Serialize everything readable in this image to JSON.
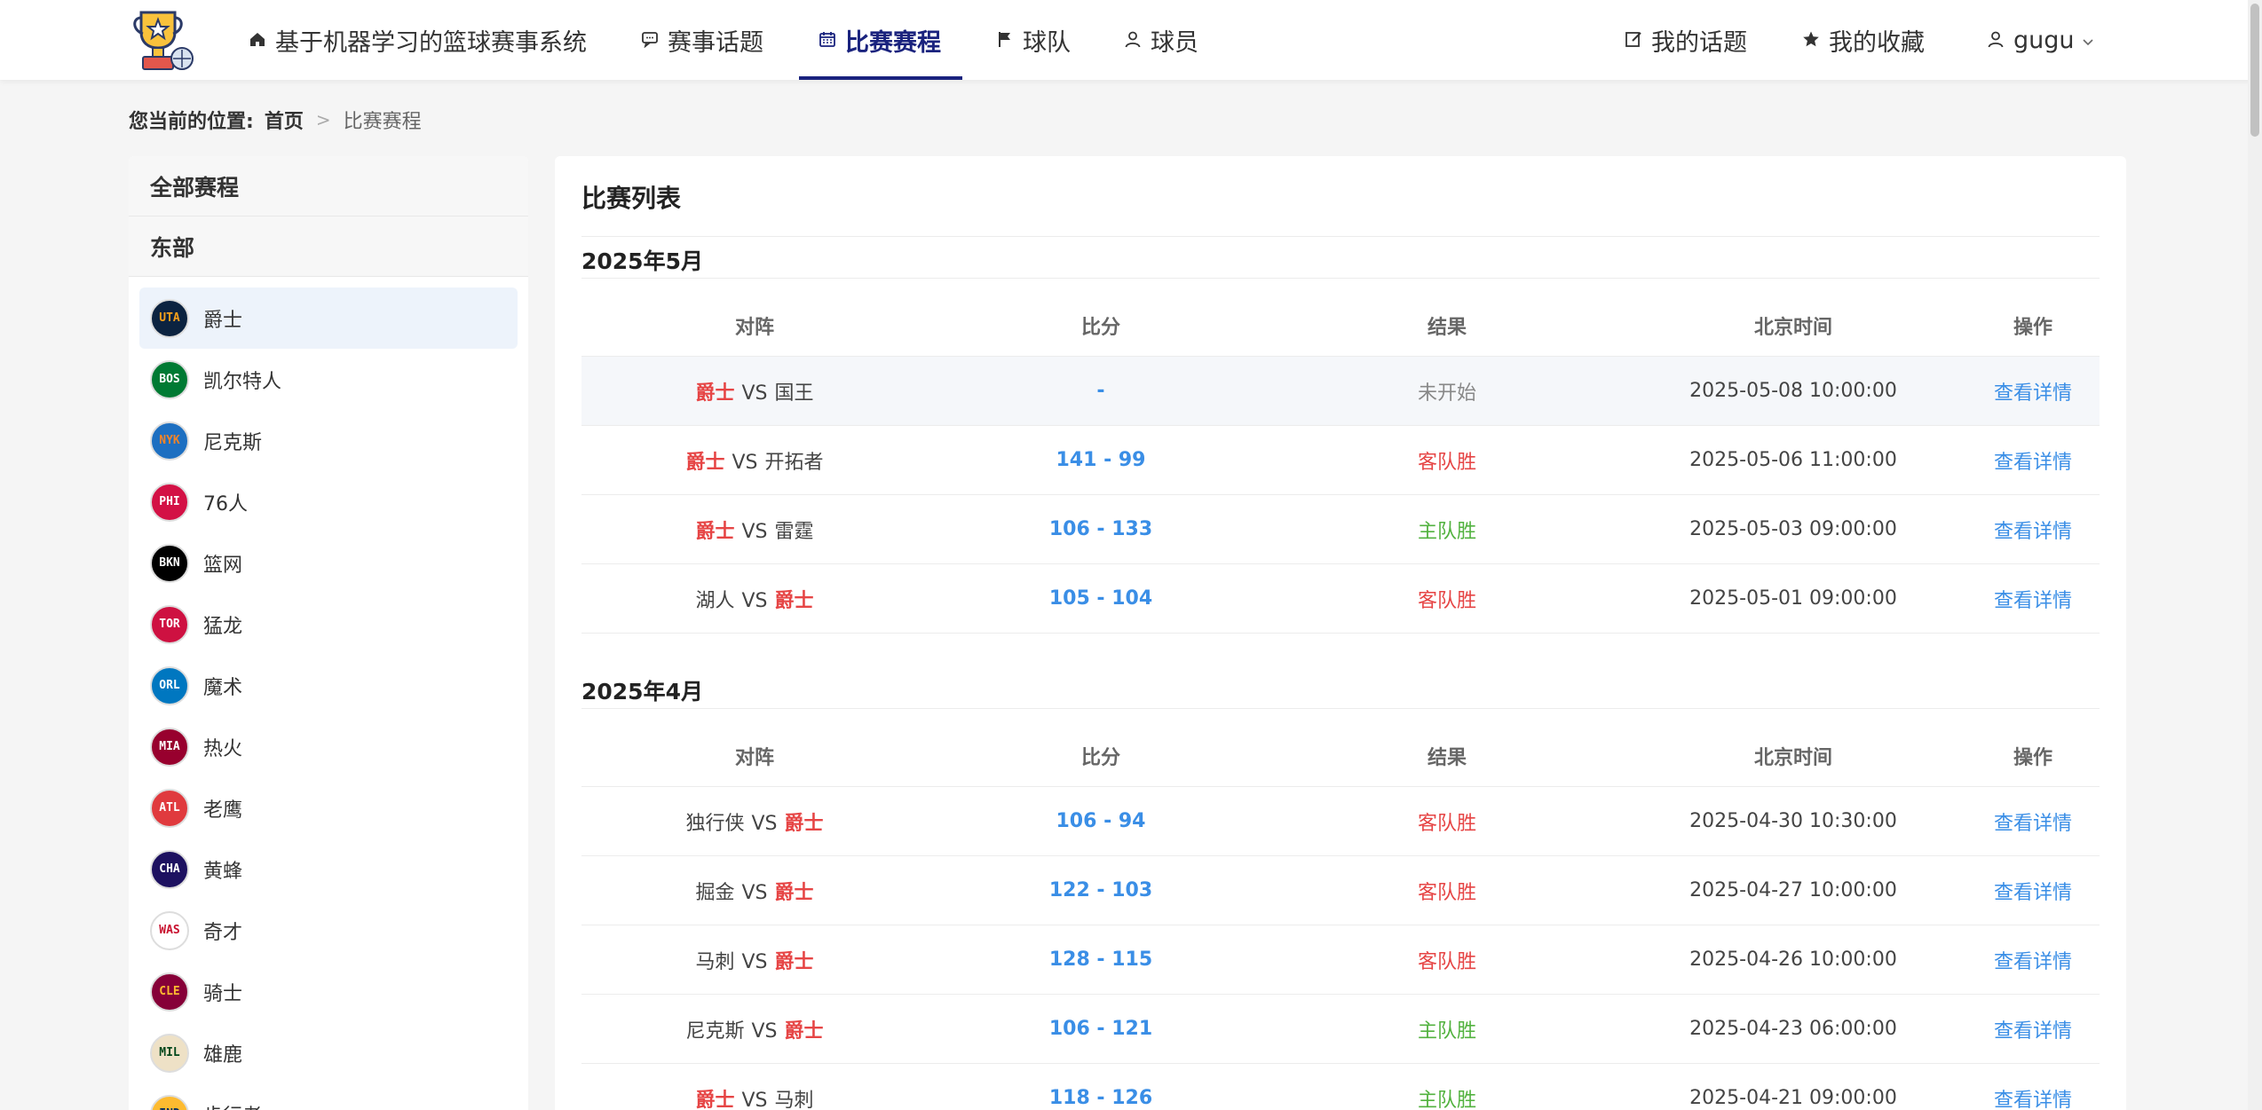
{
  "nav": {
    "brand_label": "基于机器学习的篮球赛事系统",
    "topics_label": "赛事话题",
    "schedule_label": "比赛赛程",
    "teams_label": "球队",
    "players_label": "球员",
    "my_topics_label": "我的话题",
    "favorites_label": "我的收藏",
    "user_label": "gugu"
  },
  "breadcrumb": {
    "label": "您当前的位置:",
    "home": "首页",
    "separator": ">",
    "current": "比赛赛程"
  },
  "sidebar": {
    "all_label": "全部赛程",
    "group_label": "东部",
    "teams": [
      {
        "abbr": "UTA",
        "name": "爵士",
        "bg": "#0c2340",
        "fg": "#f9a01b"
      },
      {
        "abbr": "BOS",
        "name": "凯尔特人",
        "bg": "#007a33",
        "fg": "#ffffff"
      },
      {
        "abbr": "NYK",
        "name": "尼克斯",
        "bg": "#1d6fc1",
        "fg": "#f58426"
      },
      {
        "abbr": "PHI",
        "name": "76人",
        "bg": "#d31145",
        "fg": "#ffffff"
      },
      {
        "abbr": "BKN",
        "name": "篮网",
        "bg": "#000000",
        "fg": "#ffffff"
      },
      {
        "abbr": "TOR",
        "name": "猛龙",
        "bg": "#ce1141",
        "fg": "#ffffff"
      },
      {
        "abbr": "ORL",
        "name": "魔术",
        "bg": "#0077c0",
        "fg": "#ffffff"
      },
      {
        "abbr": "MIA",
        "name": "热火",
        "bg": "#98002e",
        "fg": "#ffffff"
      },
      {
        "abbr": "ATL",
        "name": "老鹰",
        "bg": "#e03a3e",
        "fg": "#ffffff"
      },
      {
        "abbr": "CHA",
        "name": "黄蜂",
        "bg": "#1d1160",
        "fg": "#ffffff"
      },
      {
        "abbr": "WAS",
        "name": "奇才",
        "bg": "#ffffff",
        "fg": "#c8102e"
      },
      {
        "abbr": "CLE",
        "name": "骑士",
        "bg": "#860038",
        "fg": "#fdbb30"
      },
      {
        "abbr": "MIL",
        "name": "雄鹿",
        "bg": "#eee1c6",
        "fg": "#00471b"
      },
      {
        "abbr": "IND",
        "name": "步行者",
        "bg": "#fdbb30",
        "fg": "#002d62"
      }
    ]
  },
  "main": {
    "title": "比赛列表",
    "headers": {
      "matchup": "对阵",
      "score": "比分",
      "result": "结果",
      "time": "北京时间",
      "action": "操作"
    },
    "months": [
      {
        "title": "2025年5月",
        "games": [
          {
            "home": "爵士",
            "vs": "VS",
            "away": "国王",
            "jazz_side": "home",
            "score": "-",
            "result": "未开始",
            "result_type": "pending",
            "time": "2025-05-08 10:00:00",
            "action": "查看详情",
            "highlight": true
          },
          {
            "home": "爵士",
            "vs": "VS",
            "away": "开拓者",
            "jazz_side": "home",
            "score": "141 - 99",
            "result": "客队胜",
            "result_type": "away",
            "time": "2025-05-06 11:00:00",
            "action": "查看详情",
            "highlight": false
          },
          {
            "home": "爵士",
            "vs": "VS",
            "away": "雷霆",
            "jazz_side": "home",
            "score": "106 - 133",
            "result": "主队胜",
            "result_type": "home",
            "time": "2025-05-03 09:00:00",
            "action": "查看详情",
            "highlight": false
          },
          {
            "home": "湖人",
            "vs": "VS",
            "away": "爵士",
            "jazz_side": "away",
            "score": "105 - 104",
            "result": "客队胜",
            "result_type": "away",
            "time": "2025-05-01 09:00:00",
            "action": "查看详情",
            "highlight": false
          }
        ]
      },
      {
        "title": "2025年4月",
        "games": [
          {
            "home": "独行侠",
            "vs": "VS",
            "away": "爵士",
            "jazz_side": "away",
            "score": "106 - 94",
            "result": "客队胜",
            "result_type": "away",
            "time": "2025-04-30 10:30:00",
            "action": "查看详情",
            "highlight": false
          },
          {
            "home": "掘金",
            "vs": "VS",
            "away": "爵士",
            "jazz_side": "away",
            "score": "122 - 103",
            "result": "客队胜",
            "result_type": "away",
            "time": "2025-04-27 10:00:00",
            "action": "查看详情",
            "highlight": false
          },
          {
            "home": "马刺",
            "vs": "VS",
            "away": "爵士",
            "jazz_side": "away",
            "score": "128 - 115",
            "result": "客队胜",
            "result_type": "away",
            "time": "2025-04-26 10:00:00",
            "action": "查看详情",
            "highlight": false
          },
          {
            "home": "尼克斯",
            "vs": "VS",
            "away": "爵士",
            "jazz_side": "away",
            "score": "106 - 121",
            "result": "主队胜",
            "result_type": "home",
            "time": "2025-04-23 06:00:00",
            "action": "查看详情",
            "highlight": false
          },
          {
            "home": "爵士",
            "vs": "VS",
            "away": "马刺",
            "jazz_side": "home",
            "score": "118 - 126",
            "result": "主队胜",
            "result_type": "home",
            "time": "2025-04-21 09:00:00",
            "action": "查看详情",
            "highlight": false
          }
        ]
      }
    ]
  }
}
